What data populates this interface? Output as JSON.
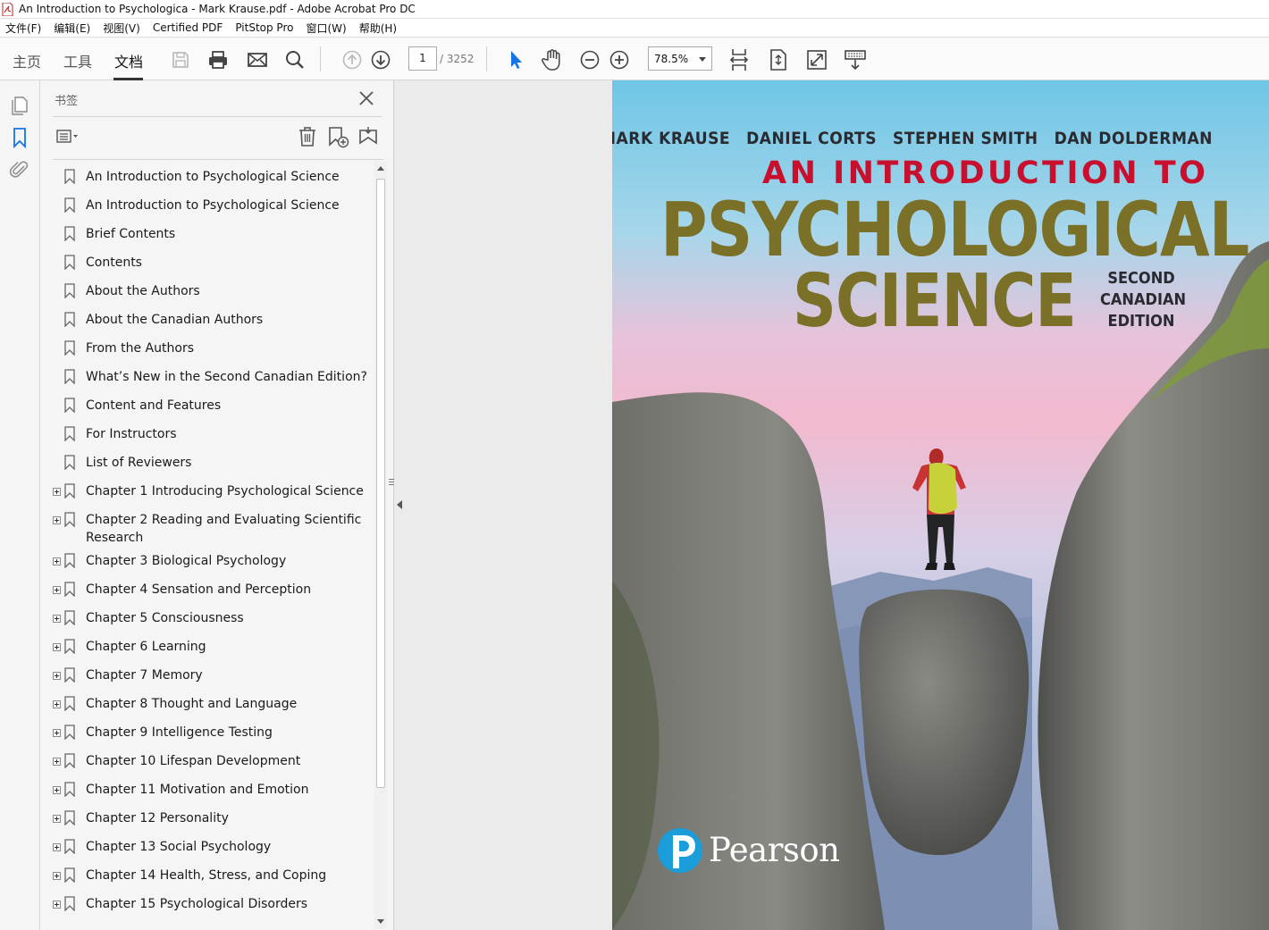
{
  "window": {
    "title": "An Introduction to Psychologica - Mark Krause.pdf - Adobe Acrobat Pro DC"
  },
  "menu": [
    {
      "label": "文件(F)"
    },
    {
      "label": "编辑(E)"
    },
    {
      "label": "视图(V)"
    },
    {
      "label": "Certified PDF"
    },
    {
      "label": "PitStop Pro"
    },
    {
      "label": "窗口(W)"
    },
    {
      "label": "帮助(H)"
    }
  ],
  "toolbar": {
    "tabs": [
      "主页",
      "工具",
      "文档"
    ],
    "active_tab": "文档",
    "page_current": "1",
    "page_total": "/ 3252",
    "zoom": "78.5%",
    "icons": [
      "save-icon",
      "print-icon",
      "email-icon",
      "search-icon",
      "page-up-icon",
      "page-down-icon",
      "select-cursor-icon",
      "hand-tool-icon",
      "zoom-out-icon",
      "zoom-in-icon",
      "fit-width-icon",
      "fit-page-icon",
      "full-screen-icon",
      "read-mode-icon"
    ]
  },
  "left_rail": {
    "icons": [
      "page-thumbnails-icon",
      "bookmarks-icon",
      "attachments-icon"
    ]
  },
  "bookmarks": {
    "heading": "书签",
    "tools": [
      "options-menu-icon",
      "delete-bookmark-icon",
      "new-bookmark-icon",
      "bookmark-from-structure-icon"
    ],
    "items": [
      {
        "label": "An Introduction to Psychological Science",
        "expandable": false
      },
      {
        "label": "An Introduction to Psychological Science",
        "expandable": false
      },
      {
        "label": "Brief Contents",
        "expandable": false
      },
      {
        "label": "Contents",
        "expandable": false
      },
      {
        "label": "About the Authors",
        "expandable": false
      },
      {
        "label": "About the Canadian Authors",
        "expandable": false
      },
      {
        "label": "From the Authors",
        "expandable": false
      },
      {
        "label": "What’s New in the Second Canadian Edition?",
        "expandable": false
      },
      {
        "label": "Content and Features",
        "expandable": false
      },
      {
        "label": "For Instructors",
        "expandable": false
      },
      {
        "label": "List of Reviewers",
        "expandable": false
      },
      {
        "label": "Chapter 1 Introducing Psychological Science",
        "expandable": true
      },
      {
        "label": "Chapter 2 Reading and Evaluating Scientific Research",
        "expandable": true
      },
      {
        "label": "Chapter 3 Biological Psychology",
        "expandable": true
      },
      {
        "label": "Chapter 4 Sensation and Perception",
        "expandable": true
      },
      {
        "label": "Chapter 5 Consciousness",
        "expandable": true
      },
      {
        "label": "Chapter 6 Learning",
        "expandable": true
      },
      {
        "label": "Chapter 7 Memory",
        "expandable": true
      },
      {
        "label": "Chapter 8 Thought and Language",
        "expandable": true
      },
      {
        "label": "Chapter 9 Intelligence Testing",
        "expandable": true
      },
      {
        "label": "Chapter 10 Lifespan Development",
        "expandable": true
      },
      {
        "label": "Chapter 11 Motivation and Emotion",
        "expandable": true
      },
      {
        "label": "Chapter 12 Personality",
        "expandable": true
      },
      {
        "label": "Chapter 13 Social Psychology",
        "expandable": true
      },
      {
        "label": "Chapter 14 Health, Stress, and Coping",
        "expandable": true
      },
      {
        "label": "Chapter 15 Psychological Disorders",
        "expandable": true
      }
    ]
  },
  "cover": {
    "authors": [
      "MARK KRAUSE",
      "DANIEL CORTS",
      "STEPHEN SMITH",
      "DAN DOLDERMAN"
    ],
    "title_line1": "AN INTRODUCTION TO",
    "title_line2": "PSYCHOLOGICAL",
    "title_line3": "SCIENCE",
    "edition": [
      "SECOND",
      "CANADIAN",
      "EDITION"
    ],
    "publisher": "Pearson",
    "colors": {
      "title_red": "#c8102e",
      "title_olive": "#7a7028",
      "publisher_blue": "#1b9dd9"
    }
  }
}
